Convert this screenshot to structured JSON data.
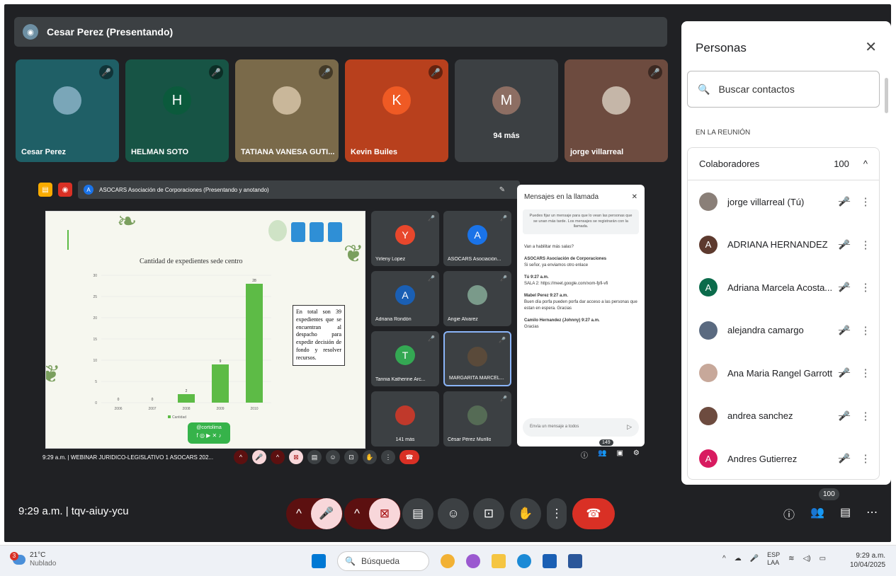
{
  "presenter_bar": {
    "title": "Cesar Perez (Presentando)"
  },
  "tiles": [
    {
      "name": "Cesar Perez",
      "initial": "",
      "bg": "#1f5f66",
      "av": "#7aa6b8"
    },
    {
      "name": "HELMAN SOTO",
      "initial": "H",
      "bg": "#175445",
      "av": "#0b5a3c"
    },
    {
      "name": "TATIANA VANESA GUTI...",
      "initial": "",
      "bg": "#7a6a4a",
      "av": "#c9b79a"
    },
    {
      "name": "Kevin Builes",
      "initial": "K",
      "bg": "#b8401d",
      "av": "#ef5a24"
    },
    {
      "name": "",
      "initial": "M",
      "bg": "#3c4043",
      "av": "#8d6e63",
      "more": "94 más"
    },
    {
      "name": "jorge villarreal",
      "initial": "",
      "bg": "#6d4b3f",
      "av": "#c5b6a8"
    }
  ],
  "presentation": {
    "bar_title": "ASOCARS Asociación de Corporaciones (Presentando y anotando)",
    "slide": {
      "chart_title": "Cantidad de expedientes sede centro",
      "textbox": "En total son 39 expedientes que se encuentran al despacho para expedir decisión de fondo y resolver recursos.",
      "handle": "@cortolima"
    },
    "mini_tiles": [
      {
        "name": "Yirleny Lopez",
        "initial": "Y",
        "color": "#e8472c"
      },
      {
        "name": "ASOCARS Asociación...",
        "initial": "A",
        "color": "#1a73e8"
      },
      {
        "name": "Adriana Rondón",
        "initial": "A",
        "color": "#1a5fb4"
      },
      {
        "name": "Angie Alvarez",
        "initial": "",
        "color": "#7a9a8a"
      },
      {
        "name": "Tannia Katherine Arc...",
        "initial": "T",
        "color": "#34a853"
      },
      {
        "name": "MARGARITA MARCEL...",
        "initial": "",
        "color": "#5a4a3a"
      },
      {
        "name": "141 más",
        "initial": "",
        "color": "#c0392b"
      },
      {
        "name": "César Pérez Murillo",
        "initial": "",
        "color": "#556b55"
      }
    ],
    "chat": {
      "title": "Mensajes en la llamada",
      "note": "Puedes fijar un mensaje para que lo vean las personas que se unan más tarde. Los mensajes se registrarán con la llamada.",
      "messages": [
        {
          "who": "",
          "text": "Van a habilitar más salas?"
        },
        {
          "who": "ASOCARS Asociación de Corporaciones",
          "text": "Si señor, ya enviamos otro enlace"
        },
        {
          "who": "Tú  9:27 a.m.",
          "text": "SALA 2: https://meet.google.com/xom-fpfi-vfi"
        },
        {
          "who": "Mabel Perez  9:27 a.m.",
          "text": "Buen día porfa pueden porfa dar acceso a las personas que estan en espera. Gracias"
        },
        {
          "who": "Camilo Hernandez (Johnny)  9:27 a.m.",
          "text": "Gracias"
        }
      ],
      "input_placeholder": "Envía un mensaje a todos"
    },
    "bottom_info": "9:29 a.m.  |  WEBINAR JURIDICO-LEGISLATIVO 1 ASOCARS 202...",
    "people_count": "149"
  },
  "chart_data": {
    "type": "bar",
    "categories": [
      "2006",
      "2007",
      "2008",
      "2009",
      "2010"
    ],
    "values": [
      0,
      0,
      2,
      9,
      28
    ],
    "title": "Cantidad de expedientes sede centro",
    "xlabel": "",
    "ylabel": "",
    "ylim": [
      0,
      30
    ],
    "yticks": [
      0,
      5,
      10,
      15,
      20,
      25,
      30
    ],
    "legend": "Cantidad",
    "color": "#5dbb46"
  },
  "bottom_bar": {
    "meeting_info": "9:29 a.m.  |  tqv-aiuy-ycu",
    "people_badge": "100"
  },
  "people_panel": {
    "title": "Personas",
    "search_placeholder": "Buscar contactos",
    "section_label": "EN LA REUNIÓN",
    "group_label": "Colaboradores",
    "group_count": "100",
    "people": [
      {
        "name": "jorge villarreal (Tú)",
        "initial": "",
        "color": "#8a7f78"
      },
      {
        "name": "ADRIANA HERNANDEZ",
        "initial": "A",
        "color": "#5d3a2e"
      },
      {
        "name": "Adriana Marcela Acosta...",
        "initial": "A",
        "color": "#0b6b4b"
      },
      {
        "name": "alejandra camargo",
        "initial": "",
        "color": "#5a6a80"
      },
      {
        "name": "Ana Maria Rangel Garrott",
        "initial": "",
        "color": "#c7a89a"
      },
      {
        "name": "andrea sanchez",
        "initial": "",
        "color": "#6d4b3f"
      },
      {
        "name": "Andres Gutierrez",
        "initial": "A",
        "color": "#d81b60"
      }
    ]
  },
  "taskbar": {
    "weather_temp": "21°C",
    "weather_desc": "Nublado",
    "weather_badge": "3",
    "search_label": "Búsqueda",
    "lang_line1": "ESP",
    "lang_line2": "LAA",
    "time": "9:29 a.m.",
    "date": "10/04/2025"
  }
}
